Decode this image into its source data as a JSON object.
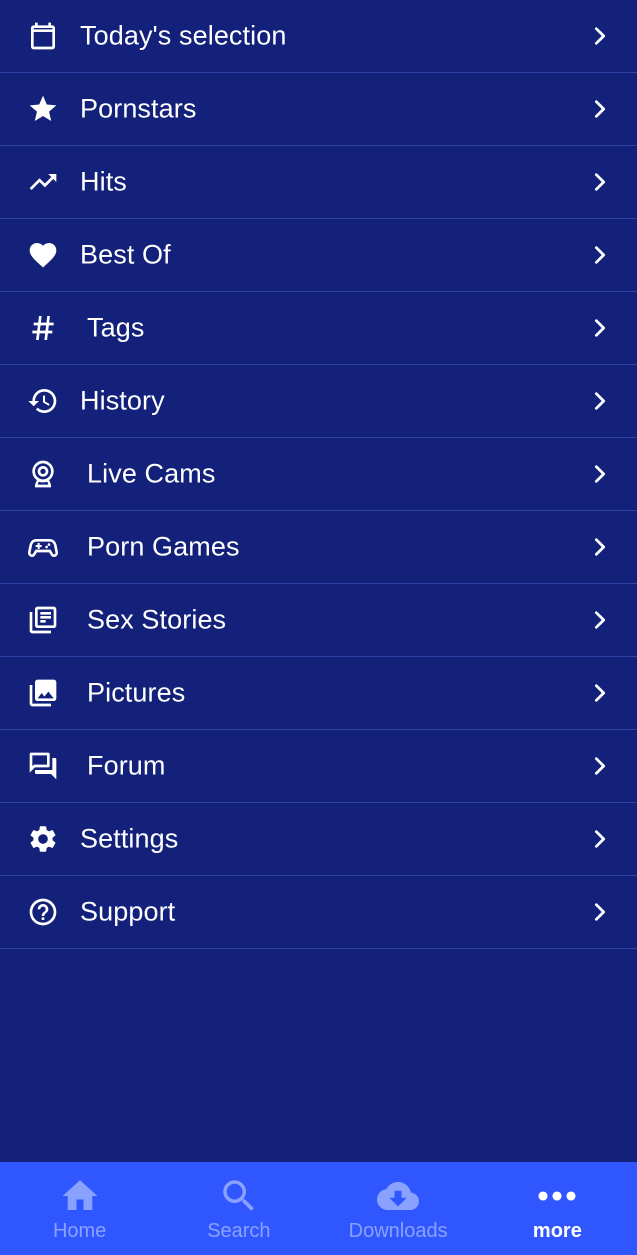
{
  "colors": {
    "background": "#13217a",
    "divider": "#2f43a6",
    "bottom_nav_bg": "#3057ff",
    "nav_inactive": "#8aa2ff",
    "nav_active": "#ffffff"
  },
  "menu": {
    "items": [
      {
        "label": "Today's selection",
        "icon": "calendar-icon"
      },
      {
        "label": "Pornstars",
        "icon": "star-icon"
      },
      {
        "label": "Hits",
        "icon": "trending-up-icon"
      },
      {
        "label": "Best Of",
        "icon": "heart-icon"
      },
      {
        "label": "Tags",
        "icon": "hashtag-icon"
      },
      {
        "label": "History",
        "icon": "history-icon"
      },
      {
        "label": "Live Cams",
        "icon": "webcam-icon"
      },
      {
        "label": "Porn Games",
        "icon": "gamepad-icon"
      },
      {
        "label": "Sex Stories",
        "icon": "stories-icon"
      },
      {
        "label": "Pictures",
        "icon": "pictures-icon"
      },
      {
        "label": "Forum",
        "icon": "forum-icon"
      },
      {
        "label": "Settings",
        "icon": "gear-icon"
      },
      {
        "label": "Support",
        "icon": "help-circle-icon"
      }
    ]
  },
  "bottom_nav": {
    "items": [
      {
        "label": "Home",
        "icon": "home-icon"
      },
      {
        "label": "Search",
        "icon": "search-icon"
      },
      {
        "label": "Downloads",
        "icon": "cloud-download-icon"
      },
      {
        "label": "more",
        "icon": "more-dots-icon"
      }
    ],
    "active": "more"
  }
}
